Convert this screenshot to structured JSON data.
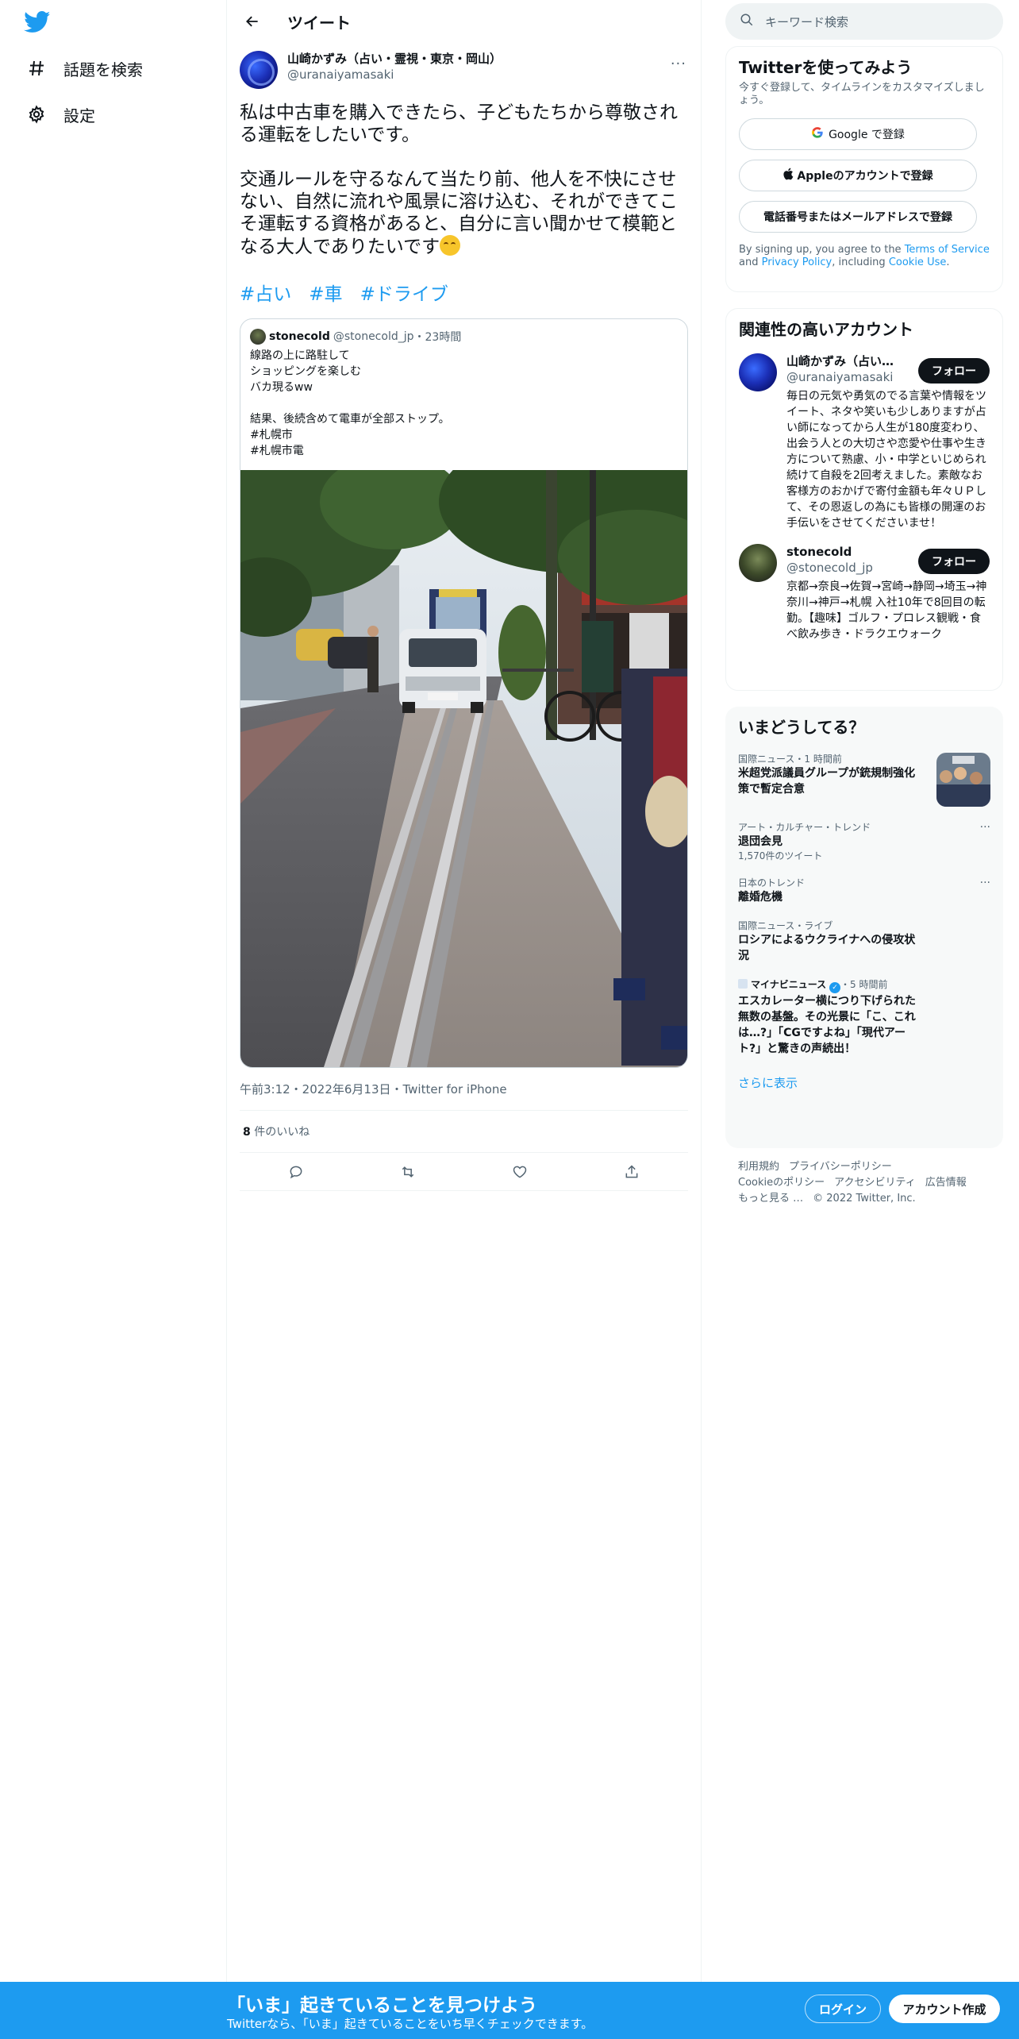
{
  "nav": {
    "explore_label": "話題を検索",
    "settings_label": "設定"
  },
  "header": {
    "title": "ツイート"
  },
  "tweet": {
    "author_name": "山崎かずみ（占い・霊視・東京・岡山）",
    "author_handle": "@uranaiyamasaki",
    "text_p1": "私は中古車を購入できたら、子どもたちから尊敬される運転をしたいです。",
    "text_p2": "交通ルールを守るなんて当たり前、他人を不快にさせない、自然に流れや風景に溶け込む、それができてこそ運転する資格があると、自分に言い聞かせて模範となる大人でありたいです",
    "hashtags": [
      "#占い",
      "#車",
      "#ドライブ"
    ],
    "quote": {
      "name": "stonecold",
      "handle": "@stonecold_jp",
      "time": "・23時間",
      "text": "線路の上に路駐して\nショッピングを楽しむ\nバカ現るww\n\n結果、後続含めて電車が全部ストップ。\n#札幌市\n #札幌市電"
    },
    "timestamp": "午前3:12・2022年6月13日・Twitter for iPhone",
    "likes_count": "8",
    "likes_label": " 件のいいね"
  },
  "search": {
    "placeholder": "キーワード検索"
  },
  "signup_card": {
    "title": "Twitterを使ってみよう",
    "subtitle": "今すぐ登録して、タイムラインをカスタマイズしましょう。",
    "google_label": "Google で登録",
    "apple_label": "Appleのアカウントで登録",
    "phone_label": "電話番号またはメールアドレスで登録",
    "legal_prefix": "By signing up, you agree to the ",
    "tos_link": "Terms of Service",
    "legal_and": " and ",
    "privacy_link": "Privacy Policy",
    "legal_including": ", including ",
    "cookie_link": "Cookie Use",
    "legal_end": "."
  },
  "related": {
    "title": "関連性の高いアカウント",
    "accounts": [
      {
        "name": "山崎かずみ（占い・霊視・東京・岡山）",
        "handle": "@uranaiyamasaki",
        "bio": "毎日の元気や勇気のでる言葉や情報をツイート、ネタや笑いも少しありますが占い師になってから人生が180度変わり、出会う人との大切さや恋愛や仕事や生き方について熟慮、小・中学といじめられ続けて自殺を2回考えました。素敵なお客様方のおかげで寄付金額も年々ＵＰして、その恩返しの為にも皆様の開運のお手伝いをさせてくださいませ！",
        "follow_label": "フォロー"
      },
      {
        "name": "stonecold",
        "handle": "@stonecold_jp",
        "bio": "京都→奈良→佐賀→宮崎→静岡→埼玉→神奈川→神戸→札幌 入社10年で8回目の転勤。【趣味】ゴルフ・プロレス観戦・食べ飲み歩き・ドラクエウォーク",
        "follow_label": "フォロー"
      }
    ]
  },
  "trends": {
    "title": "いまどうしてる？",
    "items": [
      {
        "context": "国際ニュース・1 時間前",
        "title": "米超党派議員グループが銃規制強化策で暫定合意",
        "count": ""
      },
      {
        "context": "アート・カルチャー・トレンド",
        "title": "退団会見",
        "count": "1,570件のツイート"
      },
      {
        "context": "日本のトレンド",
        "title": "離婚危機",
        "count": ""
      },
      {
        "context": "国際ニュース・ライブ",
        "title": "ロシアによるウクライナへの侵攻状況",
        "count": ""
      },
      {
        "context_source": "マイナビニュース",
        "context_time": "・5 時間前",
        "title": "エスカレーター横につり下げられた無数の基盤。その光景に「こ、これは…?」「CGですよね」「現代アート?」と驚きの声続出！",
        "count": ""
      }
    ],
    "show_more": "さらに表示"
  },
  "footer": {
    "links": [
      "利用規約",
      "プライバシーポリシー",
      "Cookieのポリシー",
      "アクセシビリティ",
      "広告情報",
      "もっと見る …",
      "© 2022 Twitter, Inc."
    ]
  },
  "bottom_bar": {
    "title": "「いま」起きていることを見つけよう",
    "subtitle": "Twitterなら、「いま」起きていることをいち早くチェックできます。",
    "login_label": "ログイン",
    "signup_label": "アカウント作成"
  },
  "colors": {
    "accent": "#1d9bf0",
    "text": "#0f1419",
    "secondary": "#536471"
  }
}
